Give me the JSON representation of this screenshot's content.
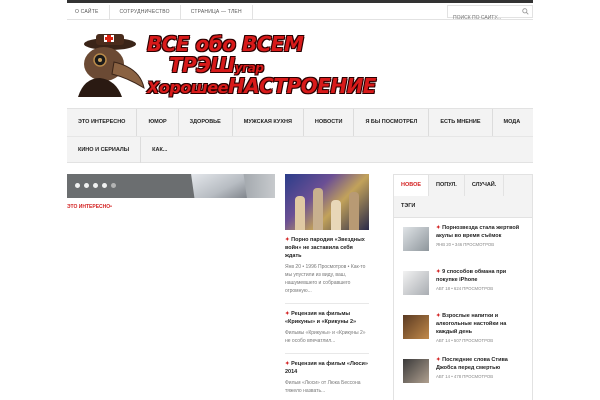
{
  "topbar": {
    "links": [
      "О САЙТЕ",
      "СОТРУДНИЧЕСТВО",
      "СТРАНИЦА — ТЛЕН"
    ],
    "search_placeholder": "ПОИСК ПО САЙТУ..."
  },
  "header": {
    "logo_line1": "ВСЕ обо ВСЕМ",
    "logo_line2_a": "ТРЭШ",
    "logo_line2_b": "угар",
    "logo_line3_a": "Хорошее",
    "logo_line3_b": "НАСТРОЕНИЕ"
  },
  "nav": {
    "row1": [
      "ЭТО ИНТЕРЕСНО",
      "ЮМОР",
      "ЗДОРОВЬЕ",
      "МУЖСКАЯ КУХНЯ",
      "НОВОСТИ",
      "Я БЫ ПОСМОТРЕЛ",
      "ЕСТЬ МНЕНИЕ",
      "МОДА"
    ],
    "row2": [
      "КИНО И СЕРИАЛЫ",
      "КАК..."
    ]
  },
  "slider": {
    "category": "ЭТО ИНТЕРЕСНО"
  },
  "middle": {
    "posts": [
      {
        "title": "Порно пародия «Звездных войн» не заставила себя ждать",
        "meta": "Янв 20 • 1996 Просмотров • Как-то мы упустили из виду, ваш, нашумевшего и собравшего огромную..."
      },
      {
        "title": "Рецензия на фильмы «Крикуны» и «Крикуны 2»",
        "meta": "Фильмы «Крикуны» и «Крикуны 2» не особо впечатлил..."
      },
      {
        "title": "Рецензия на фильм «Люси» 2014",
        "meta": "Фильм «Люси» от Люка Бессона тяжело назвать..."
      }
    ]
  },
  "sidebar": {
    "tabs": [
      "НОВОЕ",
      "ПОПУЛ.",
      "СЛУЧАЙ.",
      "ТЭГИ"
    ],
    "posts": [
      {
        "title": "Порнозвезда стала жертвой акулы во время съёмок",
        "meta": "ЯНВ 20 • 346 ПРОСМОТРОВ"
      },
      {
        "title": "9 способов обмана при покупке iPhone",
        "meta": "АВГ 18 • 624 ПРОСМОТРОВ"
      },
      {
        "title": "Взрослые напитки и алкогольные настойки на каждый день",
        "meta": "АВГ 14 • 507 ПРОСМОТРОВ"
      },
      {
        "title": "Последние слова Стива Джобса перед смертью",
        "meta": "АВГ 14 • 478 ПРОСМОТРОВ"
      }
    ]
  }
}
